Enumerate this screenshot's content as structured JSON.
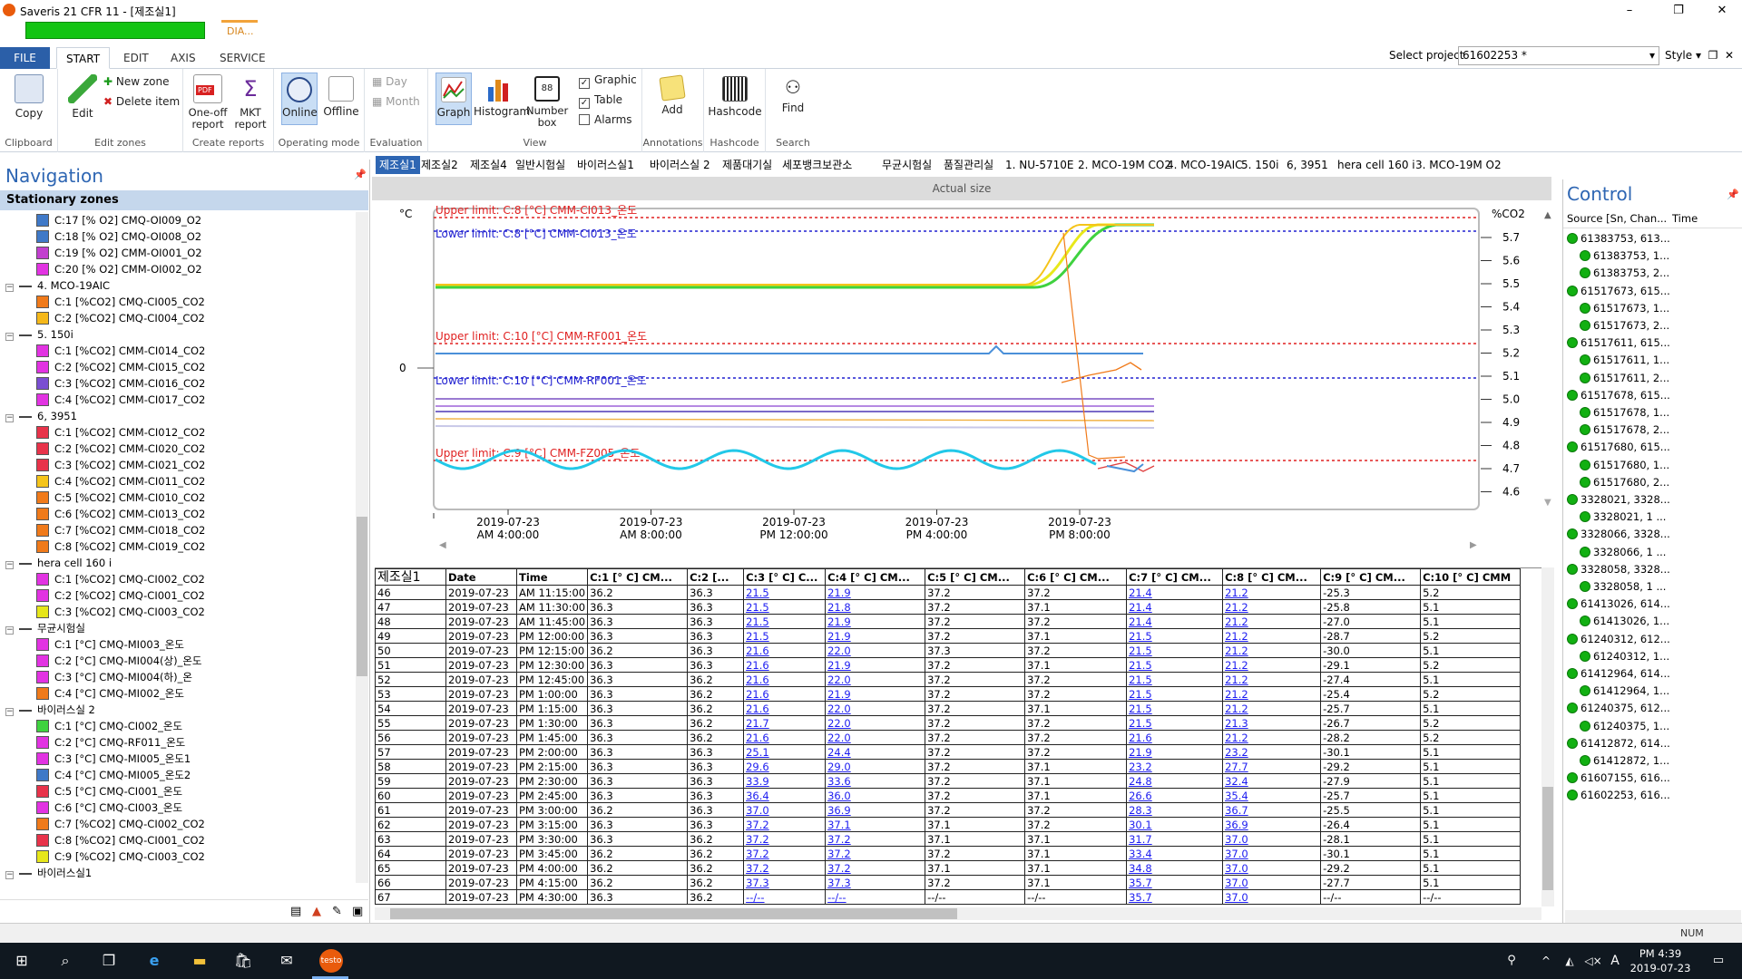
{
  "window": {
    "title": "Saveris 21 CFR 11 - [제조실1]",
    "min": "–",
    "max": "❐",
    "close": "✕"
  },
  "dia_label": "DIA...",
  "menu_tabs": [
    {
      "label": "FILE"
    },
    {
      "label": "START"
    },
    {
      "label": "EDIT"
    },
    {
      "label": "AXIS"
    },
    {
      "label": "SERVICE"
    }
  ],
  "project": {
    "label": "Select project",
    "value": "61602253  *",
    "style": "Style"
  },
  "ribbon": {
    "copy": "Copy",
    "clipboard": "Clipboard",
    "edit": "Edit",
    "new_zone": "New zone",
    "delete_item": "Delete item",
    "edit_zones": "Edit zones",
    "oneoff_report": "One-off report",
    "mkt_report": "MKT report",
    "create_reports": "Create reports",
    "online": "Online",
    "offline": "Offline",
    "operating_mode": "Operating mode",
    "day": "Day",
    "month": "Month",
    "evaluation": "Evaluation",
    "graph": "Graph",
    "histogram": "Histogram",
    "number_box": "Number box",
    "graphic": "Graphic",
    "table": "Table",
    "alarms": "Alarms",
    "view": "View",
    "add": "Add",
    "annotations": "Annotations",
    "hashcode": "Hashcode",
    "hashcode_group": "Hashcode",
    "find": "Find",
    "search": "Search"
  },
  "nav": {
    "title": "Navigation",
    "header": "Stationary zones",
    "rows": [
      {
        "type": "ch",
        "color": "#3f79c8",
        "label": "C:17 [% O2]  CMQ-OI009_O2"
      },
      {
        "type": "ch",
        "color": "#3f79c8",
        "label": "C:18 [% O2]  CMQ-OI008_O2"
      },
      {
        "type": "ch",
        "color": "#c23fcf",
        "label": "C:19 [% O2]  CMM-OI001_O2"
      },
      {
        "type": "ch",
        "color": "#e233e2",
        "label": "C:20 [% O2]  CMM-OI002_O2"
      },
      {
        "type": "zone",
        "label": "4. MCO-19AIC"
      },
      {
        "type": "ch",
        "color": "#f07a1a",
        "label": "C:1 [%CO2]  CMQ-CI005_CO2"
      },
      {
        "type": "ch",
        "color": "#f5b81a",
        "label": "C:2 [%CO2]  CMQ-CI004_CO2"
      },
      {
        "type": "zone",
        "label": "5. 150i"
      },
      {
        "type": "ch",
        "color": "#e233e2",
        "label": "C:1 [%CO2]  CMM-CI014_CO2"
      },
      {
        "type": "ch",
        "color": "#e233e2",
        "label": "C:2 [%CO2]  CMM-CI015_CO2"
      },
      {
        "type": "ch",
        "color": "#7a4fd2",
        "label": "C:3 [%CO2]  CMM-CI016_CO2"
      },
      {
        "type": "ch",
        "color": "#e233e2",
        "label": "C:4 [%CO2]  CMM-CI017_CO2"
      },
      {
        "type": "zone",
        "label": "6, 3951"
      },
      {
        "type": "ch",
        "color": "#e8334a",
        "label": "C:1 [%CO2]  CMM-CI012_CO2"
      },
      {
        "type": "ch",
        "color": "#e8334a",
        "label": "C:2 [%CO2]  CMM-CI020_CO2"
      },
      {
        "type": "ch",
        "color": "#e8334a",
        "label": "C:3 [%CO2]  CMM-CI021_CO2"
      },
      {
        "type": "ch",
        "color": "#f5c41a",
        "label": "C:4 [%CO2]  CMM-CI011_CO2"
      },
      {
        "type": "ch",
        "color": "#f07a1a",
        "label": "C:5 [%CO2]  CMM-CI010_CO2"
      },
      {
        "type": "ch",
        "color": "#f07a1a",
        "label": "C:6 [%CO2]  CMM-CI013_CO2"
      },
      {
        "type": "ch",
        "color": "#f07a1a",
        "label": "C:7 [%CO2]  CMM-CI018_CO2"
      },
      {
        "type": "ch",
        "color": "#f07a1a",
        "label": "C:8 [%CO2]  CMM-CI019_CO2"
      },
      {
        "type": "zone",
        "label": "hera cell 160 i"
      },
      {
        "type": "ch",
        "color": "#e233e2",
        "label": "C:1 [%CO2]  CMQ-CI002_CO2"
      },
      {
        "type": "ch",
        "color": "#e233e2",
        "label": "C:2 [%CO2]  CMQ-CI001_CO2"
      },
      {
        "type": "ch",
        "color": "#e6e61a",
        "label": "C:3 [%CO2]  CMQ-CI003_CO2"
      },
      {
        "type": "zone",
        "label": "무균시험실"
      },
      {
        "type": "ch",
        "color": "#e233e2",
        "label": "C:1 [°C]  CMQ-MI003_온도"
      },
      {
        "type": "ch",
        "color": "#e233e2",
        "label": "C:2 [°C]  CMQ-MI004(상)_온도"
      },
      {
        "type": "ch",
        "color": "#e233e2",
        "label": "C:3 [°C]  CMQ-MI004(하)_온"
      },
      {
        "type": "ch",
        "color": "#f07a1a",
        "label": "C:4 [°C]  CMQ-MI002_온도"
      },
      {
        "type": "zone",
        "label": "바이러스실 2"
      },
      {
        "type": "ch",
        "color": "#3fd23f",
        "label": "C:1 [°C]  CMQ-CI002_온도"
      },
      {
        "type": "ch",
        "color": "#e233e2",
        "label": "C:2 [°C]  CMQ-RF011_온도"
      },
      {
        "type": "ch",
        "color": "#e233e2",
        "label": "C:3 [°C]  CMQ-MI005_온도1"
      },
      {
        "type": "ch",
        "color": "#3f79c8",
        "label": "C:4 [°C]  CMQ-MI005_온도2"
      },
      {
        "type": "ch",
        "color": "#e8334a",
        "label": "C:5 [°C]  CMQ-CI001_온도"
      },
      {
        "type": "ch",
        "color": "#e233e2",
        "label": "C:6 [°C]  CMQ-CI003_온도"
      },
      {
        "type": "ch",
        "color": "#f07a1a",
        "label": "C:7 [%CO2]  CMQ-CI002_CO2"
      },
      {
        "type": "ch",
        "color": "#e8334a",
        "label": "C:8 [%CO2]  CMQ-CI001_CO2"
      },
      {
        "type": "ch",
        "color": "#e6e61a",
        "label": "C:9 [%CO2]  CMQ-CI003_CO2"
      },
      {
        "type": "zone",
        "label": "바이러스실1"
      }
    ]
  },
  "zone_tabs": [
    "제조실1",
    "제조실2",
    "제조실4",
    "일반시험실",
    "바이러스실1",
    "바이러스실 2",
    "제품대기실",
    "세포뱅크보관소",
    "무균시험실",
    "품질관리실",
    "1. NU-5710E",
    "2. MCO-19M CO2",
    "4. MCO-19AIC",
    "5. 150i",
    "6, 3951",
    "hera cell 160 i",
    "3. MCO-19M O2"
  ],
  "actual_size": "Actual size",
  "chart_data": {
    "type": "line",
    "left_unit": "°C",
    "right_unit": "%CO2",
    "left_tick": "0",
    "right_ticks": [
      "5.7",
      "5.6",
      "5.5",
      "5.4",
      "5.3",
      "5.2",
      "5.1",
      "5.0",
      "4.9",
      "4.8",
      "4.7",
      "4.6"
    ],
    "x_ticks": [
      {
        "date": "2019-07-23",
        "time": "AM 4:00:00"
      },
      {
        "date": "2019-07-23",
        "time": "AM 8:00:00"
      },
      {
        "date": "2019-07-23",
        "time": "PM 12:00:00"
      },
      {
        "date": "2019-07-23",
        "time": "PM 4:00:00"
      },
      {
        "date": "2019-07-23",
        "time": "PM 8:00:00"
      }
    ],
    "limits": [
      {
        "text": "Upper limit: C:8 [°C] CMM-CI013_온도",
        "color": "#e02020"
      },
      {
        "text": "Lower limit: C:8 [°C] CMM-CI013_온도",
        "color": "#2020d0"
      },
      {
        "text": "Upper limit: C:10 [°C] CMM-RF001_온도",
        "color": "#e02020"
      },
      {
        "text": "Lower limit: C:10 [°C] CMM-RF001_온도",
        "color": "#2020d0"
      },
      {
        "text": "Upper limit: C:9 [°C] CMM-FZ005_온도",
        "color": "#e02020"
      }
    ]
  },
  "table": {
    "zone": "제조실1",
    "headers": [
      "Date",
      "Time",
      "C:1 [°  C] CM...",
      "C:2 [...",
      "C:3 [°  C] C...",
      "C:4 [°  C] CM...",
      "C:5 [°  C] CM...",
      "C:6 [°  C] CM...",
      "C:7 [°  C] CM...",
      "C:8 [°  C] CM...",
      "C:9 [°  C] CM...",
      "C:10 [°  C] CMM"
    ],
    "rows": [
      [
        "46",
        "2019-07-23",
        "AM 11:15:00",
        "36.2",
        "36.3",
        "21.5",
        "21.9",
        "37.2",
        "37.2",
        "21.4",
        "21.2",
        "-25.3",
        "5.2"
      ],
      [
        "47",
        "2019-07-23",
        "AM 11:30:00",
        "36.3",
        "36.3",
        "21.5",
        "21.8",
        "37.2",
        "37.1",
        "21.4",
        "21.2",
        "-25.8",
        "5.1"
      ],
      [
        "48",
        "2019-07-23",
        "AM 11:45:00",
        "36.3",
        "36.3",
        "21.5",
        "21.9",
        "37.2",
        "37.2",
        "21.4",
        "21.2",
        "-27.0",
        "5.1"
      ],
      [
        "49",
        "2019-07-23",
        "PM 12:00:00",
        "36.3",
        "36.3",
        "21.5",
        "21.9",
        "37.2",
        "37.1",
        "21.5",
        "21.2",
        "-28.7",
        "5.2"
      ],
      [
        "50",
        "2019-07-23",
        "PM 12:15:00",
        "36.2",
        "36.3",
        "21.6",
        "22.0",
        "37.3",
        "37.2",
        "21.5",
        "21.2",
        "-30.0",
        "5.1"
      ],
      [
        "51",
        "2019-07-23",
        "PM 12:30:00",
        "36.3",
        "36.3",
        "21.6",
        "21.9",
        "37.2",
        "37.1",
        "21.5",
        "21.2",
        "-29.1",
        "5.2"
      ],
      [
        "52",
        "2019-07-23",
        "PM 12:45:00",
        "36.3",
        "36.2",
        "21.6",
        "22.0",
        "37.2",
        "37.2",
        "21.5",
        "21.2",
        "-27.4",
        "5.1"
      ],
      [
        "53",
        "2019-07-23",
        "PM 1:00:00",
        "36.3",
        "36.2",
        "21.6",
        "21.9",
        "37.2",
        "37.2",
        "21.5",
        "21.2",
        "-25.4",
        "5.2"
      ],
      [
        "54",
        "2019-07-23",
        "PM 1:15:00",
        "36.3",
        "36.2",
        "21.6",
        "22.0",
        "37.2",
        "37.1",
        "21.5",
        "21.2",
        "-25.7",
        "5.1"
      ],
      [
        "55",
        "2019-07-23",
        "PM 1:30:00",
        "36.3",
        "36.2",
        "21.7",
        "22.0",
        "37.2",
        "37.2",
        "21.5",
        "21.3",
        "-26.7",
        "5.2"
      ],
      [
        "56",
        "2019-07-23",
        "PM 1:45:00",
        "36.3",
        "36.2",
        "21.6",
        "22.0",
        "37.2",
        "37.2",
        "21.6",
        "21.2",
        "-28.2",
        "5.2"
      ],
      [
        "57",
        "2019-07-23",
        "PM 2:00:00",
        "36.3",
        "36.3",
        "25.1",
        "24.4",
        "37.2",
        "37.2",
        "21.9",
        "23.2",
        "-30.1",
        "5.1"
      ],
      [
        "58",
        "2019-07-23",
        "PM 2:15:00",
        "36.3",
        "36.3",
        "29.6",
        "29.0",
        "37.2",
        "37.1",
        "23.2",
        "27.7",
        "-29.2",
        "5.1"
      ],
      [
        "59",
        "2019-07-23",
        "PM 2:30:00",
        "36.3",
        "36.3",
        "33.9",
        "33.6",
        "37.2",
        "37.1",
        "24.8",
        "32.4",
        "-27.9",
        "5.1"
      ],
      [
        "60",
        "2019-07-23",
        "PM 2:45:00",
        "36.3",
        "36.3",
        "36.4",
        "36.0",
        "37.2",
        "37.1",
        "26.6",
        "35.4",
        "-25.7",
        "5.1"
      ],
      [
        "61",
        "2019-07-23",
        "PM 3:00:00",
        "36.2",
        "36.3",
        "37.0",
        "36.9",
        "37.2",
        "37.2",
        "28.3",
        "36.7",
        "-25.5",
        "5.1"
      ],
      [
        "62",
        "2019-07-23",
        "PM 3:15:00",
        "36.3",
        "36.3",
        "37.2",
        "37.1",
        "37.1",
        "37.2",
        "30.1",
        "36.9",
        "-26.4",
        "5.1"
      ],
      [
        "63",
        "2019-07-23",
        "PM 3:30:00",
        "36.3",
        "36.2",
        "37.2",
        "37.2",
        "37.1",
        "37.1",
        "31.7",
        "37.0",
        "-28.1",
        "5.1"
      ],
      [
        "64",
        "2019-07-23",
        "PM 3:45:00",
        "36.2",
        "36.2",
        "37.2",
        "37.2",
        "37.2",
        "37.1",
        "33.4",
        "37.0",
        "-30.1",
        "5.1"
      ],
      [
        "65",
        "2019-07-23",
        "PM 4:00:00",
        "36.2",
        "36.2",
        "37.2",
        "37.2",
        "37.1",
        "37.1",
        "34.8",
        "37.0",
        "-29.2",
        "5.1"
      ],
      [
        "66",
        "2019-07-23",
        "PM 4:15:00",
        "36.2",
        "36.2",
        "37.3",
        "37.3",
        "37.2",
        "37.1",
        "35.7",
        "37.0",
        "-27.7",
        "5.1"
      ],
      [
        "67",
        "2019-07-23",
        "PM 4:30:00",
        "36.3",
        "36.2",
        "--/--",
        "--/--",
        "--/--",
        "--/--",
        "35.7",
        "37.0",
        "--/--",
        "--/--"
      ]
    ]
  },
  "control": {
    "title": "Control",
    "col_source": "Source [Sn, Chan...",
    "col_time": "Time",
    "rows": [
      {
        "lvl": 0,
        "label": "61383753, 613..."
      },
      {
        "lvl": 1,
        "label": "61383753, 1..."
      },
      {
        "lvl": 1,
        "label": "61383753, 2..."
      },
      {
        "lvl": 0,
        "label": "61517673, 615..."
      },
      {
        "lvl": 1,
        "label": "61517673, 1..."
      },
      {
        "lvl": 1,
        "label": "61517673, 2..."
      },
      {
        "lvl": 0,
        "label": "61517611, 615..."
      },
      {
        "lvl": 1,
        "label": "61517611, 1..."
      },
      {
        "lvl": 1,
        "label": "61517611, 2..."
      },
      {
        "lvl": 0,
        "label": "61517678, 615..."
      },
      {
        "lvl": 1,
        "label": "61517678, 1..."
      },
      {
        "lvl": 1,
        "label": "61517678, 2..."
      },
      {
        "lvl": 0,
        "label": "61517680, 615..."
      },
      {
        "lvl": 1,
        "label": "61517680, 1..."
      },
      {
        "lvl": 1,
        "label": "61517680, 2..."
      },
      {
        "lvl": 0,
        "label": "3328021, 3328..."
      },
      {
        "lvl": 1,
        "label": "3328021, 1 ..."
      },
      {
        "lvl": 0,
        "label": "3328066, 3328..."
      },
      {
        "lvl": 1,
        "label": "3328066, 1 ..."
      },
      {
        "lvl": 0,
        "label": "3328058, 3328..."
      },
      {
        "lvl": 1,
        "label": "3328058, 1 ..."
      },
      {
        "lvl": 0,
        "label": "61413026, 614..."
      },
      {
        "lvl": 1,
        "label": "61413026, 1..."
      },
      {
        "lvl": 0,
        "label": "61240312, 612..."
      },
      {
        "lvl": 1,
        "label": "61240312, 1..."
      },
      {
        "lvl": 0,
        "label": "61412964, 614..."
      },
      {
        "lvl": 1,
        "label": "61412964, 1..."
      },
      {
        "lvl": 0,
        "label": "61240375, 612..."
      },
      {
        "lvl": 1,
        "label": "61240375, 1..."
      },
      {
        "lvl": 0,
        "label": "61412872, 614..."
      },
      {
        "lvl": 1,
        "label": "61412872, 1..."
      },
      {
        "lvl": 0,
        "label": "61607155, 616..."
      },
      {
        "lvl": 0,
        "label": "61602253, 616..."
      }
    ]
  },
  "status": {
    "num": "NUM"
  },
  "taskbar": {
    "time": "PM 4:39",
    "date": "2019-07-23",
    "lang": "A"
  }
}
